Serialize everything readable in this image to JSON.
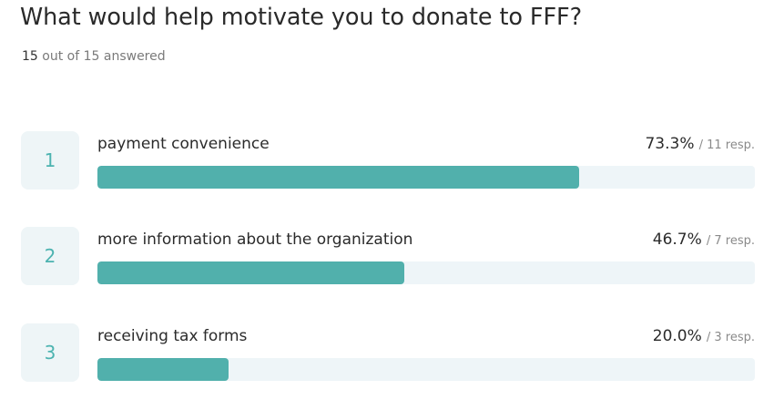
{
  "survey": {
    "question": "What would help motivate you to donate to FFF?",
    "answered_count": "15",
    "answered_suffix": "out of 15 answered"
  },
  "options": [
    {
      "rank": "1",
      "label": "payment convenience",
      "percent_text": "73.3%",
      "responses_text": "/ 11 resp.",
      "fraction": 0.733
    },
    {
      "rank": "2",
      "label": "more information about the organization",
      "percent_text": "46.7%",
      "responses_text": "/ 7 resp.",
      "fraction": 0.467
    },
    {
      "rank": "3",
      "label": "receiving tax forms",
      "percent_text": "20.0%",
      "responses_text": "/ 3 resp.",
      "fraction": 0.2
    }
  ],
  "colors": {
    "bar_fill": "#51b0ac",
    "bar_track": "#eef5f8",
    "rank_box": "#eef5f7",
    "rank_text": "#4cb3b0"
  }
}
